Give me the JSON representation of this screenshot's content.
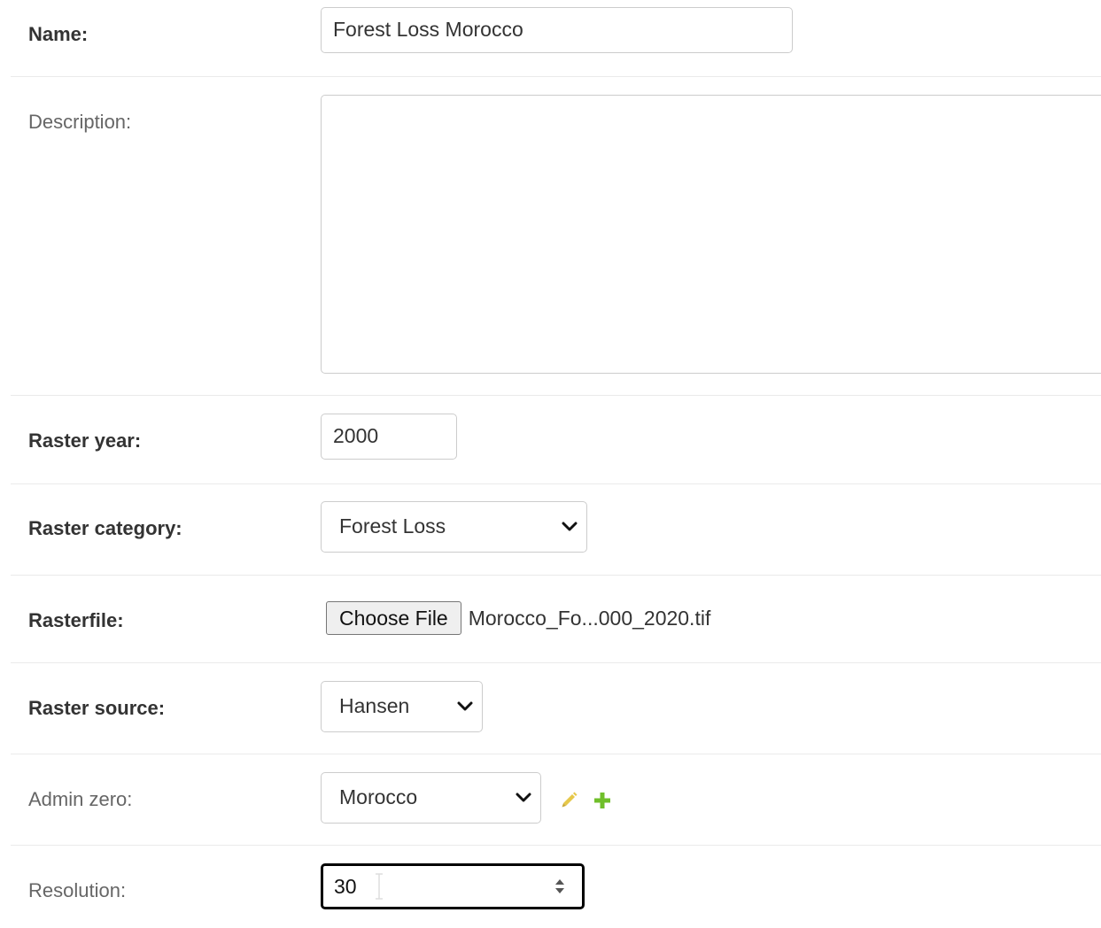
{
  "form": {
    "name": {
      "label": "Name:",
      "value": "Forest Loss Morocco"
    },
    "description": {
      "label": "Description:",
      "value": ""
    },
    "raster_year": {
      "label": "Raster year:",
      "value": "2000"
    },
    "raster_category": {
      "label": "Raster category:",
      "selected": "Forest Loss"
    },
    "rasterfile": {
      "label": "Rasterfile:",
      "button_label": "Choose File",
      "file_name": "Morocco_Fo...000_2020.tif"
    },
    "raster_source": {
      "label": "Raster source:",
      "selected": "Hansen"
    },
    "admin_zero": {
      "label": "Admin zero:",
      "selected": "Morocco",
      "edit_icon": "pencil-icon",
      "add_icon": "plus-icon"
    },
    "resolution": {
      "label": "Resolution:",
      "value": "30"
    }
  },
  "colors": {
    "edit_icon": "#e6c84a",
    "add_icon": "#70bf2b",
    "border": "#cccccc",
    "divider": "#eaeaea",
    "focus_border": "#000000"
  }
}
